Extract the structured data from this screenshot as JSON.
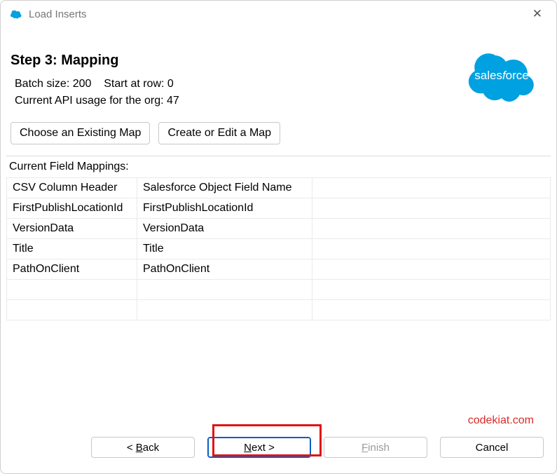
{
  "window": {
    "title": "Load Inserts"
  },
  "step": {
    "title": "Step 3: Mapping",
    "batch_label": "Batch size:",
    "batch_value": "200",
    "start_label": "Start at row:",
    "start_value": "0",
    "api_label": "Current API usage for the org:",
    "api_value": "47"
  },
  "buttons": {
    "choose_map": "Choose an Existing Map",
    "create_map": "Create or Edit a Map"
  },
  "mapping": {
    "section_label": "Current Field Mappings:",
    "header_csv": "CSV Column Header",
    "header_sf": "Salesforce Object Field Name",
    "rows": [
      {
        "csv": "FirstPublishLocationId",
        "sf": "FirstPublishLocationId"
      },
      {
        "csv": "VersionData",
        "sf": "VersionData"
      },
      {
        "csv": "Title",
        "sf": "Title"
      },
      {
        "csv": "PathOnClient",
        "sf": "PathOnClient"
      },
      {
        "csv": "",
        "sf": ""
      },
      {
        "csv": "",
        "sf": ""
      }
    ]
  },
  "watermark": "codekiat.com",
  "nav": {
    "back_pre": "< ",
    "back_ul": "B",
    "back_post": "ack",
    "next_ul": "N",
    "next_post": "ext >",
    "finish_ul": "F",
    "finish_post": "inish",
    "cancel": "Cancel"
  }
}
